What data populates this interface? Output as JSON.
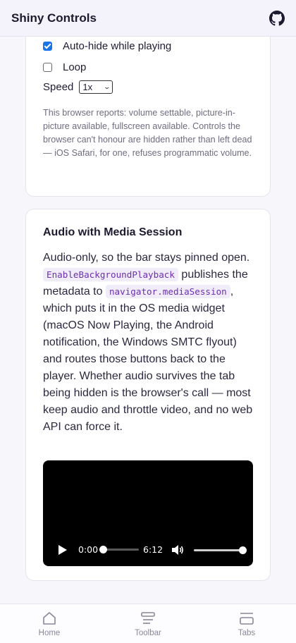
{
  "header": {
    "title": "Shiny Controls",
    "icon": "github-icon"
  },
  "controls_card": {
    "autohide": {
      "label": "Auto-hide while playing",
      "checked": true
    },
    "loop": {
      "label": "Loop",
      "checked": false
    },
    "speed": {
      "label": "Speed",
      "value": "1x"
    },
    "note": "This browser reports: volume settable, picture-in-picture available, fullscreen available. Controls the browser can't honour are hidden rather than left dead — iOS Safari, for one, refuses programmatic volume."
  },
  "audio_card": {
    "title": "Audio with Media Session",
    "text_1": "Audio-only, so the bar stays pinned open. ",
    "code_1": "EnableBackgroundPlayback",
    "text_2": " publishes the metadata to ",
    "code_2": "navigator.mediaSession",
    "text_3": ", which puts it in the OS media widget (macOS Now Playing, the Android notification, the Windows SMTC flyout) and routes those buttons back to the player. Whether audio survives the tab being hidden is the browser's call — most keep audio and throttle video, and no web API can force it.",
    "player": {
      "current_time": "0:00",
      "duration": "6:12",
      "progress": 0,
      "volume": 1
    }
  },
  "bottom_nav": {
    "home": "Home",
    "toolbar": "Toolbar",
    "tabs": "Tabs"
  },
  "colors": {
    "accent": "#1a73e8",
    "code_text": "#6b2fb0",
    "code_bg": "#f1ecfa"
  }
}
